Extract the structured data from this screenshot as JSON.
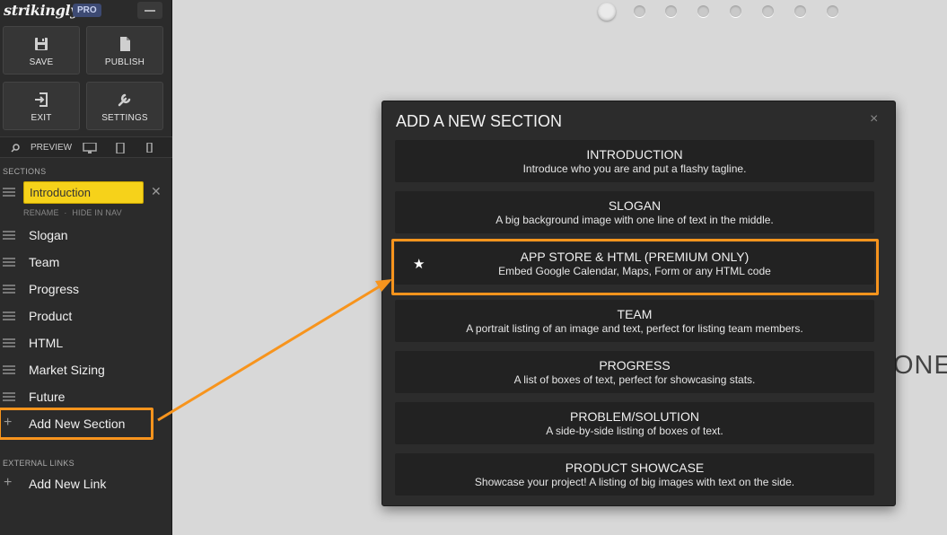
{
  "app": {
    "logo": "strikingly",
    "badge": "PRO"
  },
  "toolbar": {
    "save": "SAVE",
    "publish": "PUBLISH",
    "exit": "EXIT",
    "settings": "SETTINGS",
    "preview": "PREVIEW"
  },
  "sidebar": {
    "sections_heading": "SECTIONS",
    "active": {
      "label": "Introduction",
      "rename": "RENAME",
      "separator": "·",
      "hide": "HIDE IN NAV"
    },
    "items": [
      "Slogan",
      "Team",
      "Progress",
      "Product",
      "HTML",
      "Market Sizing",
      "Future"
    ],
    "add_section": "Add New Section",
    "external_heading": "EXTERNAL LINKS",
    "add_link": "Add New Link"
  },
  "background": {
    "partial_text": "ONE"
  },
  "modal": {
    "title": "ADD A NEW SECTION",
    "close": "×",
    "options": [
      {
        "title": "INTRODUCTION",
        "desc": "Introduce who you are and put a flashy tagline."
      },
      {
        "title": "SLOGAN",
        "desc": "A big background image with one line of text in the middle."
      },
      {
        "title": "APP STORE & HTML (PREMIUM ONLY)",
        "desc": "Embed Google Calendar, Maps, Form or any HTML code"
      },
      {
        "title": "TEAM",
        "desc": "A portrait listing of an image and text, perfect for listing team members."
      },
      {
        "title": "PROGRESS",
        "desc": "A list of boxes of text, perfect for showcasing stats."
      },
      {
        "title": "PROBLEM/SOLUTION",
        "desc": "A side-by-side listing of boxes of text."
      },
      {
        "title": "PRODUCT SHOWCASE",
        "desc": "Showcase your project! A listing of big images with text on the side."
      }
    ]
  },
  "colors": {
    "highlight": "#f7941d",
    "active_item": "#f6d21a",
    "sidebar_bg": "#2b2b2b",
    "modal_bg": "#2c2c2c"
  }
}
